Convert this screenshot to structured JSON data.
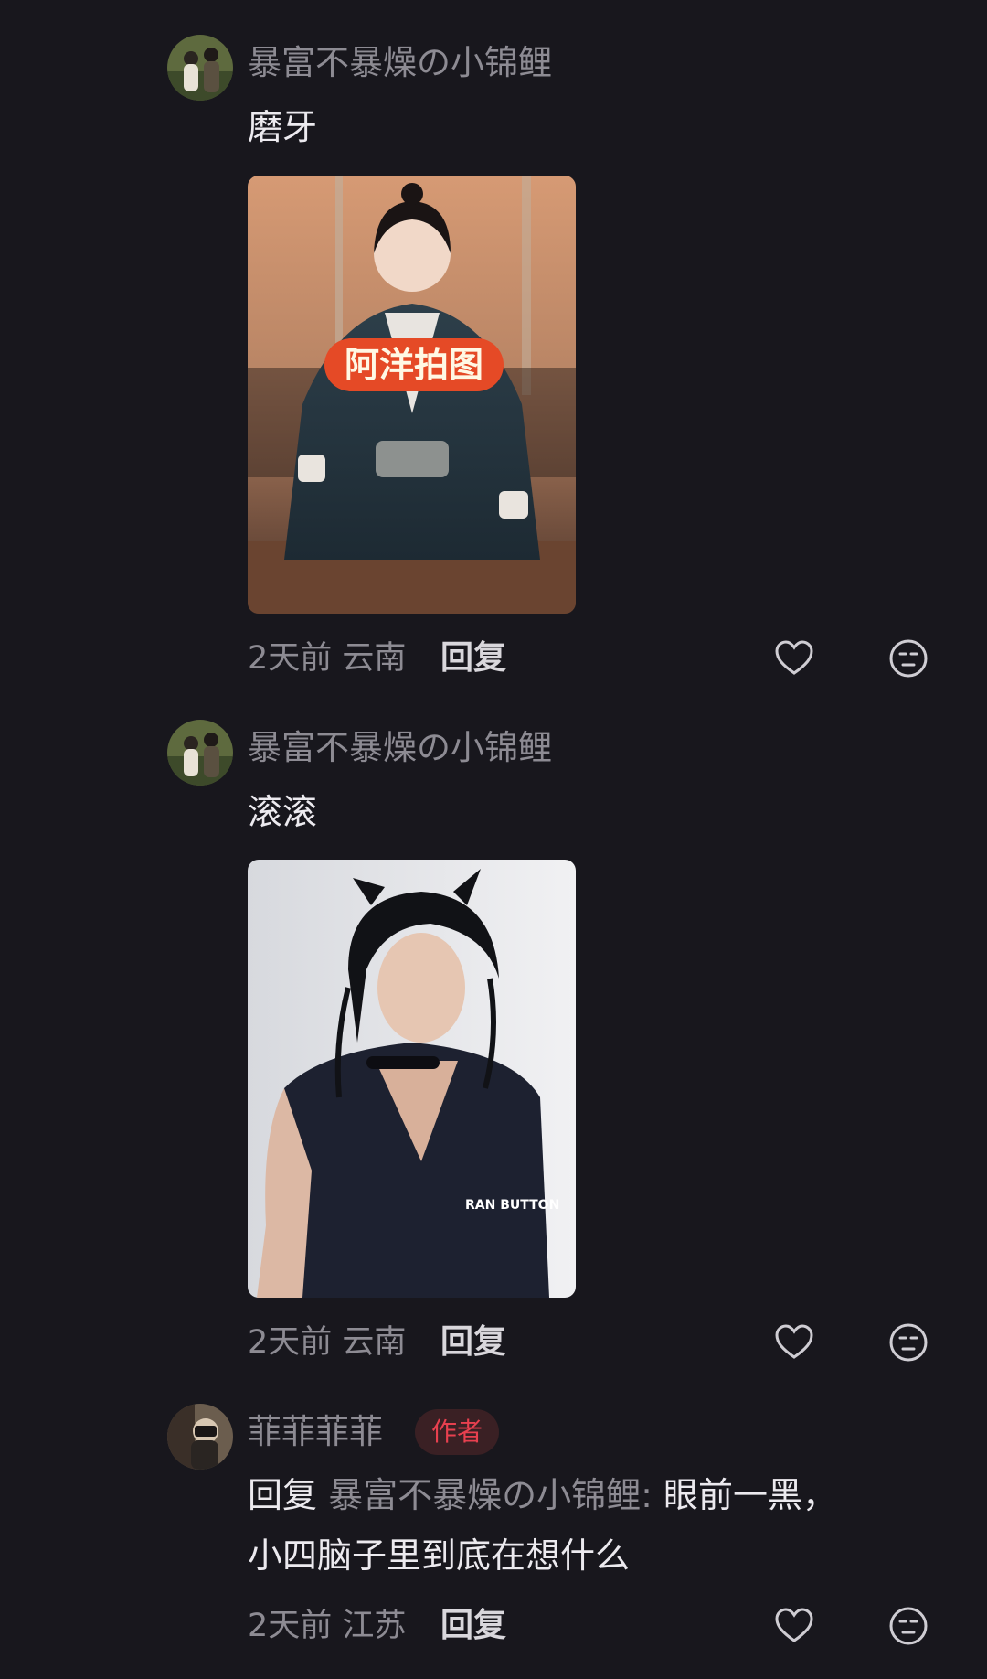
{
  "comments": [
    {
      "username": "暴富不暴燥の小锦鲤",
      "text": "磨牙",
      "photo_caption": "阿洋拍图",
      "time": "2天前",
      "location": "云南",
      "reply_label": "回复",
      "like_icon": "heart-icon",
      "dislike_icon": "unamused-face-icon"
    },
    {
      "username": "暴富不暴燥の小锦鲤",
      "text": "滚滚",
      "photo_watermark": "RAN BUTTON",
      "time": "2天前",
      "location": "云南",
      "reply_label": "回复",
      "like_icon": "heart-icon",
      "dislike_icon": "unamused-face-icon"
    },
    {
      "username": "菲菲菲菲",
      "badge": "作者",
      "reply_prefix": "回复",
      "reply_to": "暴富不暴燥の小锦鲤",
      "text_line1": "眼前一黑，",
      "text_line2": "小四脑子里到底在想什么",
      "time": "2天前",
      "location": "江苏",
      "reply_label": "回复",
      "like_icon": "heart-icon",
      "dislike_icon": "unamused-face-icon"
    }
  ],
  "colors": {
    "background": "#18171d",
    "primary_text": "#eceaef",
    "secondary_text": "#8d8b93",
    "author_badge_text": "#e8404f",
    "author_badge_bg": "#3a2024"
  }
}
